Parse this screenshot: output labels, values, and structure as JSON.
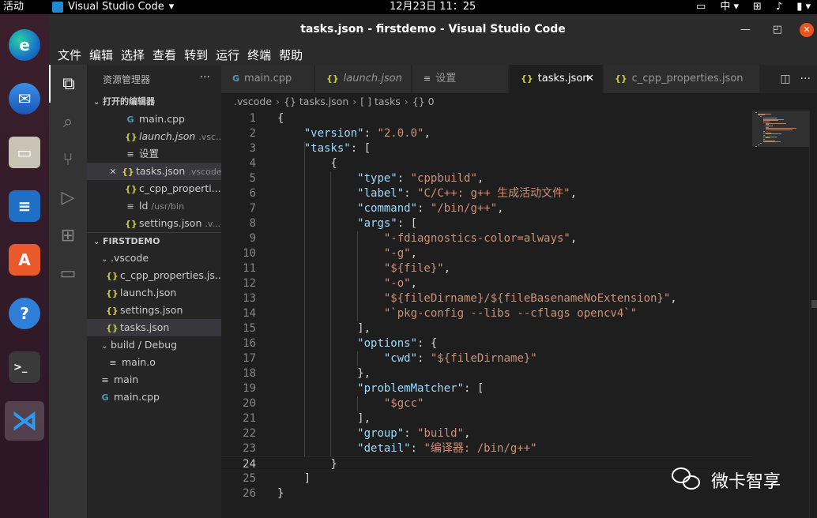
{
  "topbar": {
    "activities": "活动",
    "app_name": "Visual Studio Code",
    "app_menu_arrow": "▾",
    "clock": "12月23日  11：25",
    "ime": "中 ▾"
  },
  "window": {
    "title": "tasks.json - firstdemo - Visual Studio Code"
  },
  "menu": [
    "文件",
    "编辑",
    "选择",
    "查看",
    "转到",
    "运行",
    "终端",
    "帮助"
  ],
  "sidebar": {
    "title": "资源管理器",
    "more": "···",
    "open_editors_header": "打开的编辑器",
    "open_editors": [
      {
        "label": "main.cpp",
        "hint": "",
        "icon": "cpp"
      },
      {
        "label": "launch.json",
        "hint": ".vsc...",
        "icon": "json"
      },
      {
        "label": "设置",
        "hint": "",
        "icon": "lines"
      },
      {
        "label": "tasks.json",
        "hint": ".vscode",
        "icon": "json"
      },
      {
        "label": "c_cpp_properti...",
        "hint": "",
        "icon": "json"
      },
      {
        "label": "ld",
        "hint": "/usr/bin",
        "icon": "lines"
      },
      {
        "label": "settings.json",
        "hint": ".v...",
        "icon": "json"
      }
    ],
    "project_header": "FIRSTDEMO",
    "tree": [
      {
        "label": ".vscode",
        "icon": "folder"
      },
      {
        "label": "c_cpp_properties.js...",
        "icon": "json"
      },
      {
        "label": "launch.json",
        "icon": "json"
      },
      {
        "label": "settings.json",
        "icon": "json"
      },
      {
        "label": "tasks.json",
        "icon": "json"
      },
      {
        "label": "build / Debug",
        "icon": "folder"
      },
      {
        "label": "main.o",
        "icon": "lines"
      },
      {
        "label": "main",
        "icon": "lines"
      },
      {
        "label": "main.cpp",
        "icon": "cpp"
      }
    ]
  },
  "tabs": [
    {
      "label": "main.cpp",
      "icon": "cpp"
    },
    {
      "label": "launch.json",
      "icon": "json"
    },
    {
      "label": "设置",
      "icon": "lines"
    },
    {
      "label": "tasks.json",
      "icon": "json"
    },
    {
      "label": "c_cpp_properties.json",
      "icon": "json"
    }
  ],
  "breadcrumb": [
    ".vscode",
    "{} tasks.json",
    "[ ] tasks",
    "{} 0"
  ],
  "code": {
    "line_numbers": [
      "1",
      "2",
      "3",
      "4",
      "5",
      "6",
      "7",
      "8",
      "9",
      "10",
      "11",
      "12",
      "13",
      "14",
      "15",
      "16",
      "17",
      "18",
      "19",
      "20",
      "21",
      "22",
      "23",
      "24",
      "25",
      "26"
    ],
    "lines": [
      "{",
      "    \"version\": \"2.0.0\",",
      "    \"tasks\": [",
      "        {",
      "            \"type\": \"cppbuild\",",
      "            \"label\": \"C/C++: g++ 生成活动文件\",",
      "            \"command\": \"/bin/g++\",",
      "            \"args\": [",
      "                \"-fdiagnostics-color=always\",",
      "                \"-g\",",
      "                \"${file}\",",
      "                \"-o\",",
      "                \"${fileDirname}/${fileBasenameNoExtension}\",",
      "                \"`pkg-config --libs --cflags opencv4`\"",
      "            ],",
      "            \"options\": {",
      "                \"cwd\": \"${fileDirname}\"",
      "            },",
      "            \"problemMatcher\": [",
      "                \"$gcc\"",
      "            ],",
      "            \"group\": \"build\",",
      "            \"detail\": \"编译器: /bin/g++\"",
      "        }",
      "    ]",
      "}"
    ],
    "current_line": 24
  },
  "watermark": "微卡智享"
}
